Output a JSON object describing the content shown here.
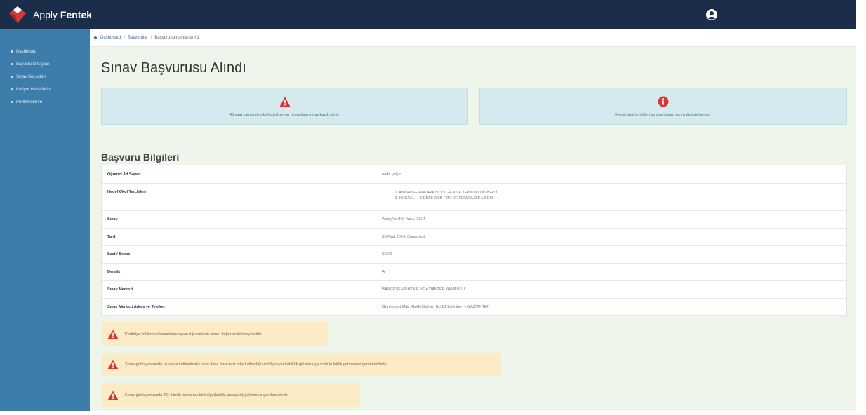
{
  "header": {
    "brand_light": "Apply ",
    "brand_bold": "Fentek",
    "user_icon": "user-circle-icon"
  },
  "sidebar": {
    "items": [
      {
        "label": "Dashboard"
      },
      {
        "label": "Başvuru Detayları"
      },
      {
        "label": "Sınav Sonuçları"
      },
      {
        "label": "Kariyer Hedeflerim"
      },
      {
        "label": "Portfolyolarım"
      }
    ]
  },
  "breadcrumb": {
    "items": [
      "Dashboard",
      "Başvurular",
      "Başvuru tamamlandı #1"
    ],
    "separator": "/"
  },
  "page_title": "Sınav Başvurusu Alındı",
  "cards": {
    "left": {
      "icon": "warning-triangle-icon",
      "text": "48 saat içerisinde aktifleştirilmeyen hesapların sınav kaydı silinir."
    },
    "right": {
      "icon": "info-circle-icon",
      "text": "Hedef okul tercihleri bu aşamadan sonra değiştirilemez."
    }
  },
  "section_title": "Başvuru Bilgileri",
  "table": {
    "rows": [
      {
        "label": "Öğrenci Ad Soyad",
        "value": "seda yalçın"
      },
      {
        "label": "Hedef Okul Tercihleri",
        "list": [
          "1. ANKARA – ANKARA 50.YIL FEN VE TEKNOLOJİ LİSESİ",
          "2. KOCAELİ – GEBZE OSB FEN VE TEKNOLOJİ LİSESİ"
        ]
      },
      {
        "label": "Sınav",
        "value": "ApplyFenTek Kabul 2024"
      },
      {
        "label": "Tarih",
        "value": "16 Mart 2024, Cumartesi"
      },
      {
        "label": "Saat / Seans",
        "value": "10:00"
      },
      {
        "label": "Derslik",
        "value": "A"
      },
      {
        "label": "Sınav Merkezi",
        "value": "BAHÇEŞEHİR KOLEJİ GAZİANTEP KAMPÜSÜ"
      },
      {
        "label": "Sınav Merkezi Adres ve Telefon",
        "value": "Güneykent Mah. Hakkı Bulvarı No:13 Şahinbey – GAZİANTEP"
      }
    ]
  },
  "warnings": [
    {
      "icon": "warning-triangle-icon",
      "text": "Portfolyo yüklemesi tamamlanmayan öğrencilerin sınavı değerlendirilmeyecektir."
    },
    {
      "icon": "warning-triangle-icon",
      "text": "Sınav günü yanınızda, sınavda kullanılmak üzere daha önce test edip kullandığınız bilgisayar kulaklık girişine uygun bir kulaklık getirmeniz gerekmektedir."
    },
    {
      "icon": "warning-triangle-icon",
      "text": "Sınav günü yanınızda T.C. kimlik numarası bir belge(kimlik, pasaport) getirmeniz gerekmektedir."
    }
  ],
  "colors": {
    "topbar": "#1c2d4a",
    "sidebar": "#3c7dab",
    "main_bg": "#eef6ec",
    "info_card": "#d4eaef",
    "warning_bg": "#fbecc6",
    "danger_icon": "#d93636"
  }
}
